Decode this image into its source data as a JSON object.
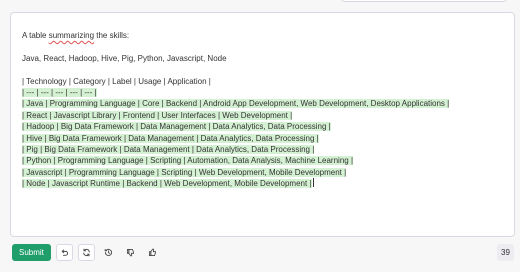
{
  "editor": {
    "intro_prefix": "A table ",
    "intro_misspelled": "summarizing",
    "intro_suffix": " the skills:",
    "skills_line": "Java, React, Hadoop, Hive, Pig, Python, Javascript, Node",
    "header_row": "| Technology | Category | Label | Usage | Application |",
    "rows": [
      "| --- | --- | --- | --- | --- |",
      "| Java | Programming Language | Core | Backend | Android App Development, Web Development, Desktop Applications |",
      "| React | Javascript Library | Frontend | User Interfaces | Web Development |",
      "| Hadoop | Big Data Framework | Data Management | Data Analytics, Data Processing |",
      "| Hive | Big Data Framework | Data Management | Data Analytics, Data Processing |",
      "| Pig | Big Data Framework | Data Management | Data Analytics, Data Processing |",
      "| Python | Programming Language | Scripting | Automation, Data Analysis, Machine Learning |",
      "| Javascript | Programming Language | Scripting | Web Development, Mobile Development |",
      "| Node | Javascript Runtime | Backend | Web Development, Mobile Development |"
    ]
  },
  "toolbar": {
    "submit_label": "Submit",
    "undo_icon": "undo-icon",
    "regenerate_icon": "regenerate-icon",
    "history_icon": "history-icon",
    "thumbs_down_icon": "thumbs-down-icon",
    "thumbs_up_icon": "thumbs-up-icon",
    "token_count": "39"
  },
  "colors": {
    "accent": "#1f9d6b",
    "highlight": "#d5f1d3",
    "border": "#d9d9e3",
    "background": "#f7f7f8"
  }
}
